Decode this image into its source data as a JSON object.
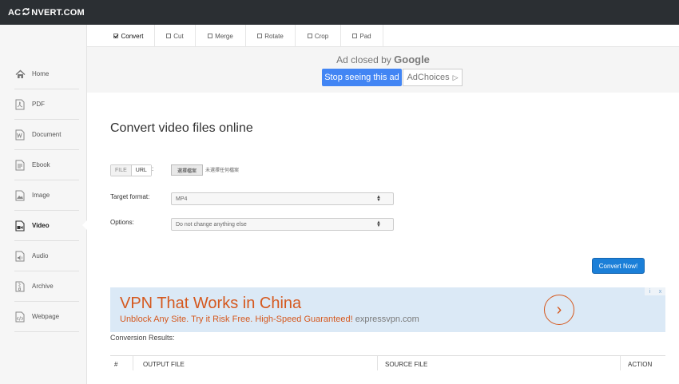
{
  "brand": {
    "logo_pre": "AC",
    "logo_post": "NVERT.COM"
  },
  "sidebar": {
    "items": [
      {
        "label": "Home",
        "icon": "home-icon"
      },
      {
        "label": "PDF",
        "icon": "pdf-icon"
      },
      {
        "label": "Document",
        "icon": "document-icon"
      },
      {
        "label": "Ebook",
        "icon": "ebook-icon"
      },
      {
        "label": "Image",
        "icon": "image-icon"
      },
      {
        "label": "Video",
        "icon": "video-icon",
        "active": true
      },
      {
        "label": "Audio",
        "icon": "audio-icon"
      },
      {
        "label": "Archive",
        "icon": "archive-icon"
      },
      {
        "label": "Webpage",
        "icon": "webpage-icon"
      }
    ]
  },
  "tabs": [
    {
      "label": "Convert",
      "active": true
    },
    {
      "label": "Cut"
    },
    {
      "label": "Merge"
    },
    {
      "label": "Rotate"
    },
    {
      "label": "Crop"
    },
    {
      "label": "Pad"
    }
  ],
  "ad_banner": {
    "closed_text": "Ad closed by",
    "google": "Google",
    "stop_button": "Stop seeing this ad",
    "adchoices": "AdChoices",
    "adchoices_icon": "▷"
  },
  "main": {
    "title": "Convert video files online",
    "file_tab": "FILE",
    "url_tab": "URL",
    "colon": ":",
    "choose_file": "選擇檔案",
    "no_file": "未選擇任何檔案",
    "target_label": "Target format:",
    "target_value": "MP4",
    "options_label": "Options:",
    "options_value": "Do not change anything else",
    "convert_button": "Convert Now!"
  },
  "vpn_ad": {
    "headline": "VPN That Works in China",
    "subline": "Unblock Any Site. Try it Risk Free. High-Speed Guaranteed!",
    "domain": "expressvpn.com",
    "arrow": "›",
    "adx_i": "i",
    "adx_x": "x"
  },
  "results": {
    "label": "Conversion Results:",
    "columns": [
      "#",
      "OUTPUT FILE",
      "SOURCE FILE",
      "ACTION"
    ]
  },
  "colors": {
    "topbar": "#2b2f33",
    "google_blue": "#4285f4",
    "convert_blue": "#1b7fd8",
    "ad_orange": "#d5591f",
    "ad_bg": "#dbe9f6"
  }
}
